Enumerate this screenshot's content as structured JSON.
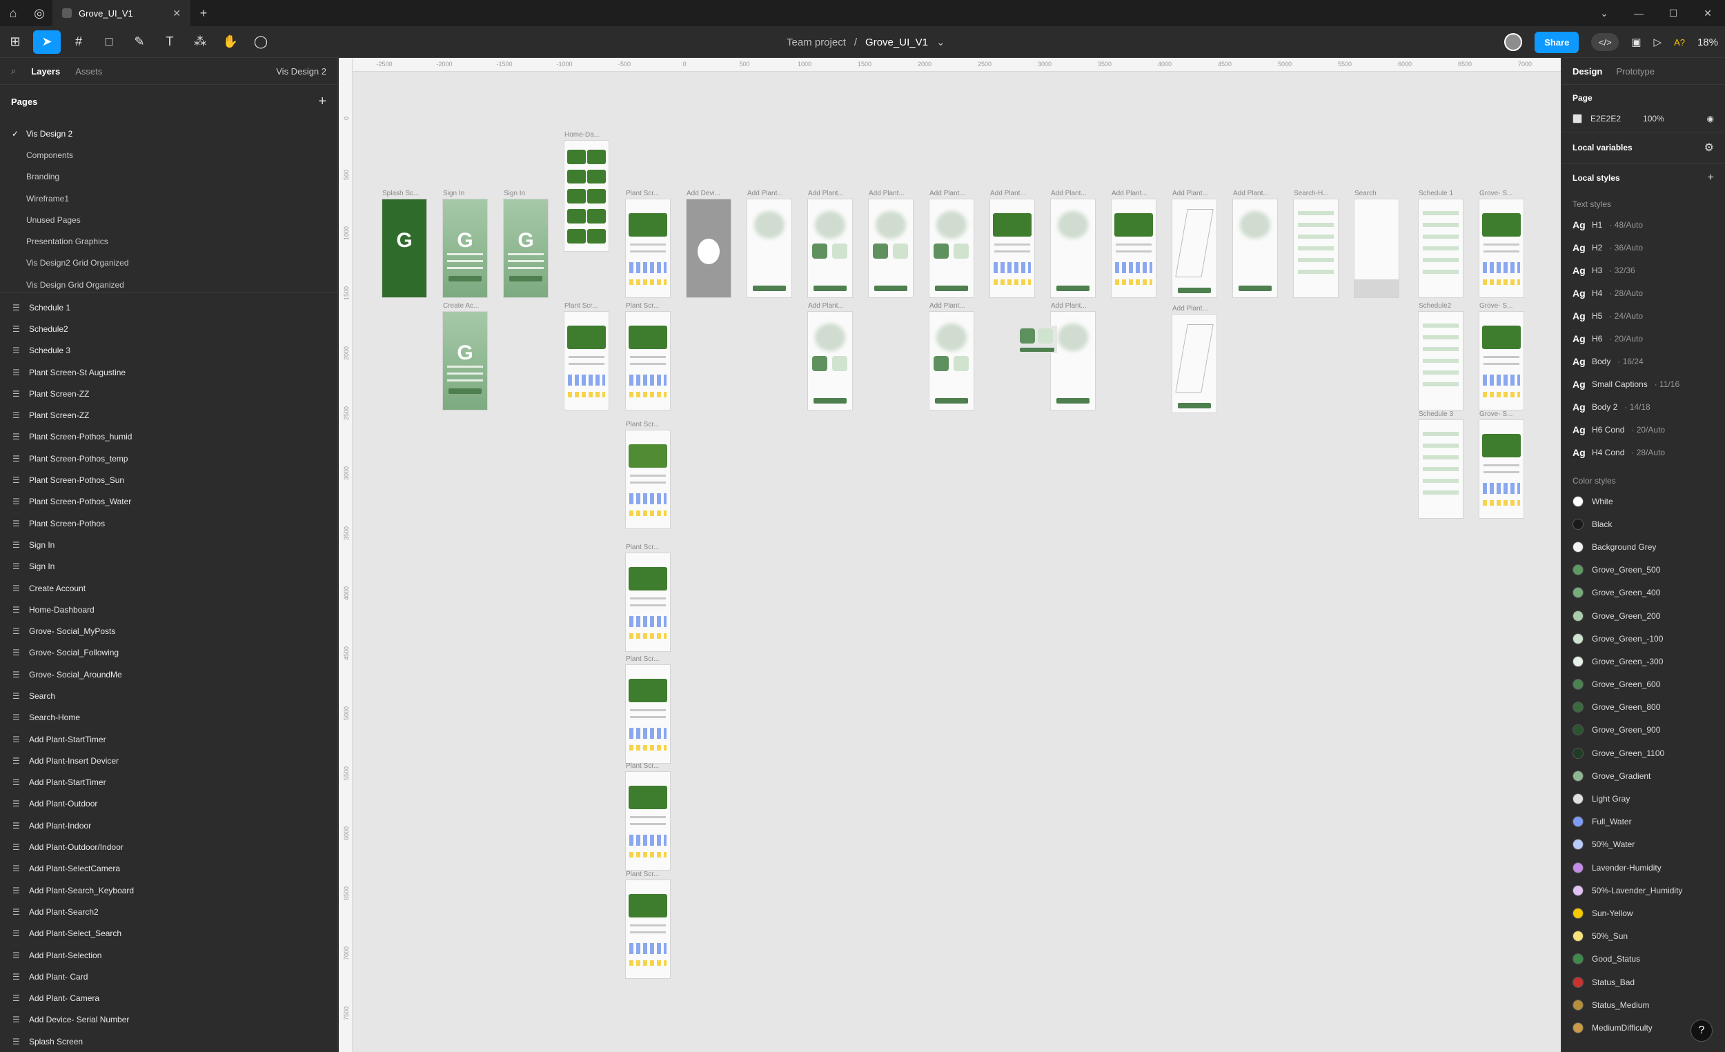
{
  "titlebar": {
    "tab_title": "Grove_UI_V1"
  },
  "toolbar": {
    "project": "Team project",
    "separator": "/",
    "file": "Grove_UI_V1",
    "share": "Share",
    "zoom": "18%",
    "ai": "A?"
  },
  "left": {
    "tabs": [
      "Layers",
      "Assets"
    ],
    "page_selector": "Vis Design 2",
    "pages_title": "Pages",
    "pages": [
      "Vis Design 2",
      "Components",
      "Branding",
      "Wireframe1",
      "Unused Pages",
      "Presentation Graphics",
      "Vis Design2 Grid Organized",
      "Vis Design Grid Organized"
    ],
    "layers": [
      "Schedule 1",
      "Schedule2",
      "Schedule 3",
      "Plant Screen-St Augustine",
      "Plant Screen-ZZ",
      "Plant Screen-ZZ",
      "Plant Screen-Pothos_humid",
      "Plant Screen-Pothos_temp",
      "Plant Screen-Pothos_Sun",
      "Plant Screen-Pothos_Water",
      "Plant Screen-Pothos",
      "Sign In",
      "Sign In",
      "Create Account",
      "Home-Dashboard",
      "Grove- Social_MyPosts",
      "Grove- Social_Following",
      "Grove- Social_AroundMe",
      "Search",
      "Search-Home",
      "Add Plant-StartTimer",
      "Add Plant-Insert Devicer",
      "Add Plant-StartTimer",
      "Add Plant-Outdoor",
      "Add Plant-Indoor",
      "Add Plant-Outdoor/Indoor",
      "Add Plant-SelectCamera",
      "Add Plant-Search_Keyboard",
      "Add Plant-Search2",
      "Add Plant-Select_Search",
      "Add Plant-Selection",
      "Add Plant- Card",
      "Add Plant- Camera",
      "Add Device- Serial Number",
      "Splash Screen"
    ]
  },
  "canvas": {
    "ruler_top": [
      "-2500",
      "-2000",
      "-1500",
      "-1000",
      "-500",
      "0",
      "500",
      "1000",
      "1500",
      "2000",
      "2500",
      "3000",
      "3500",
      "4000",
      "4500",
      "5000",
      "5500",
      "6000",
      "6500",
      "7000"
    ],
    "ruler_left": [
      "0",
      "500",
      "1000",
      "1500",
      "2000",
      "2500",
      "3000",
      "3500",
      "4000",
      "4500",
      "5000",
      "5500",
      "6000",
      "6500",
      "7000",
      "7500"
    ],
    "frame_labels": {
      "splash": "Splash Sc...",
      "signin1": "Sign In",
      "signin2": "Sign In",
      "home": "Home-Da...",
      "create": "Create Ac...",
      "plant1": "Plant Scr...",
      "adddev": "Add Devi...",
      "add1": "Add Plant...",
      "add2": "Add Plant...",
      "add3": "Add Plant...",
      "add4": "Add Plant...",
      "add5": "Add Plant...",
      "add6": "Add Plant...",
      "add7": "Add Plant...",
      "add8": "Add Plant...",
      "add9": "Add Plant...",
      "searchhome": "Search-H...",
      "search": "Search",
      "sched1": "Schedule 1",
      "grove1": "Grove- S...",
      "plant2a": "Plant Scr...",
      "plant2b": "Plant Scr...",
      "add2r2": "Add Plant...",
      "add4r2": "Add Plant...",
      "add6r2": "Add Plant...",
      "add8r2": "Add Plant...",
      "sched2": "Schedule2",
      "grove2": "Grove- S...",
      "sched3": "Schedule 3",
      "grove3": "Grove- S...",
      "plant3": "Plant Scr...",
      "plant4": "Plant Scr...",
      "plant5": "Plant Scr...",
      "plant6": "Plant Scr...",
      "plant7": "Plant Scr..."
    },
    "logo_text": "G"
  },
  "right": {
    "tabs": [
      "Design",
      "Prototype"
    ],
    "page_title": "Page",
    "page_color": "E2E2E2",
    "page_opacity": "100%",
    "local_variables": "Local variables",
    "local_styles": "Local styles",
    "text_styles_title": "Text styles",
    "text_styles": [
      {
        "name": "H1",
        "meta": "· 48/Auto"
      },
      {
        "name": "H2",
        "meta": "· 36/Auto"
      },
      {
        "name": "H3",
        "meta": "· 32/36"
      },
      {
        "name": "H4",
        "meta": "· 28/Auto"
      },
      {
        "name": "H5",
        "meta": "· 24/Auto"
      },
      {
        "name": "H6",
        "meta": "· 20/Auto"
      },
      {
        "name": "Body",
        "meta": "· 16/24"
      },
      {
        "name": "Small Captions",
        "meta": "· 11/16"
      },
      {
        "name": "Body 2",
        "meta": "· 14/18"
      },
      {
        "name": "H6 Cond",
        "meta": "· 20/Auto"
      },
      {
        "name": "H4 Cond",
        "meta": "· 28/Auto"
      }
    ],
    "ag": "Ag",
    "color_styles_title": "Color styles",
    "color_styles": [
      {
        "name": "White",
        "color": "#ffffff"
      },
      {
        "name": "Black",
        "color": "#1a1a1a"
      },
      {
        "name": "Background Grey",
        "color": "#f2f2f2"
      },
      {
        "name": "Grove_Green_500",
        "color": "#5e9a62"
      },
      {
        "name": "Grove_Green_400",
        "color": "#78ad7b"
      },
      {
        "name": "Grove_Green_200",
        "color": "#a9cdaa"
      },
      {
        "name": "Grove_Green_-100",
        "color": "#cfe3cf"
      },
      {
        "name": "Grove_Green_-300",
        "color": "#e6f0e6"
      },
      {
        "name": "Grove_Green_600",
        "color": "#4a8250"
      },
      {
        "name": "Grove_Green_800",
        "color": "#3a6a40"
      },
      {
        "name": "Grove_Green_900",
        "color": "#2b5431"
      },
      {
        "name": "Grove_Green_1100",
        "color": "#1f3d24"
      },
      {
        "name": "Grove_Gradient",
        "color": "#8fb892"
      },
      {
        "name": "Light Gray",
        "color": "#e0e0e0"
      },
      {
        "name": "Full_Water",
        "color": "#7d9cf5"
      },
      {
        "name": "50%_Water",
        "color": "#b9cbf8"
      },
      {
        "name": "Lavender-Humidity",
        "color": "#c48be8"
      },
      {
        "name": "50%-Lavender_Humidity",
        "color": "#e0c3f3"
      },
      {
        "name": "Sun-Yellow",
        "color": "#f5c800"
      },
      {
        "name": "50%_Sun",
        "color": "#f9e27a"
      },
      {
        "name": "Good_Status",
        "color": "#3f8a4a"
      },
      {
        "name": "Status_Bad",
        "color": "#c9332f"
      },
      {
        "name": "Status_Medium",
        "color": "#b58f3c"
      },
      {
        "name": "MediumDifficulty",
        "color": "#c99a4a"
      }
    ],
    "help": "?"
  }
}
